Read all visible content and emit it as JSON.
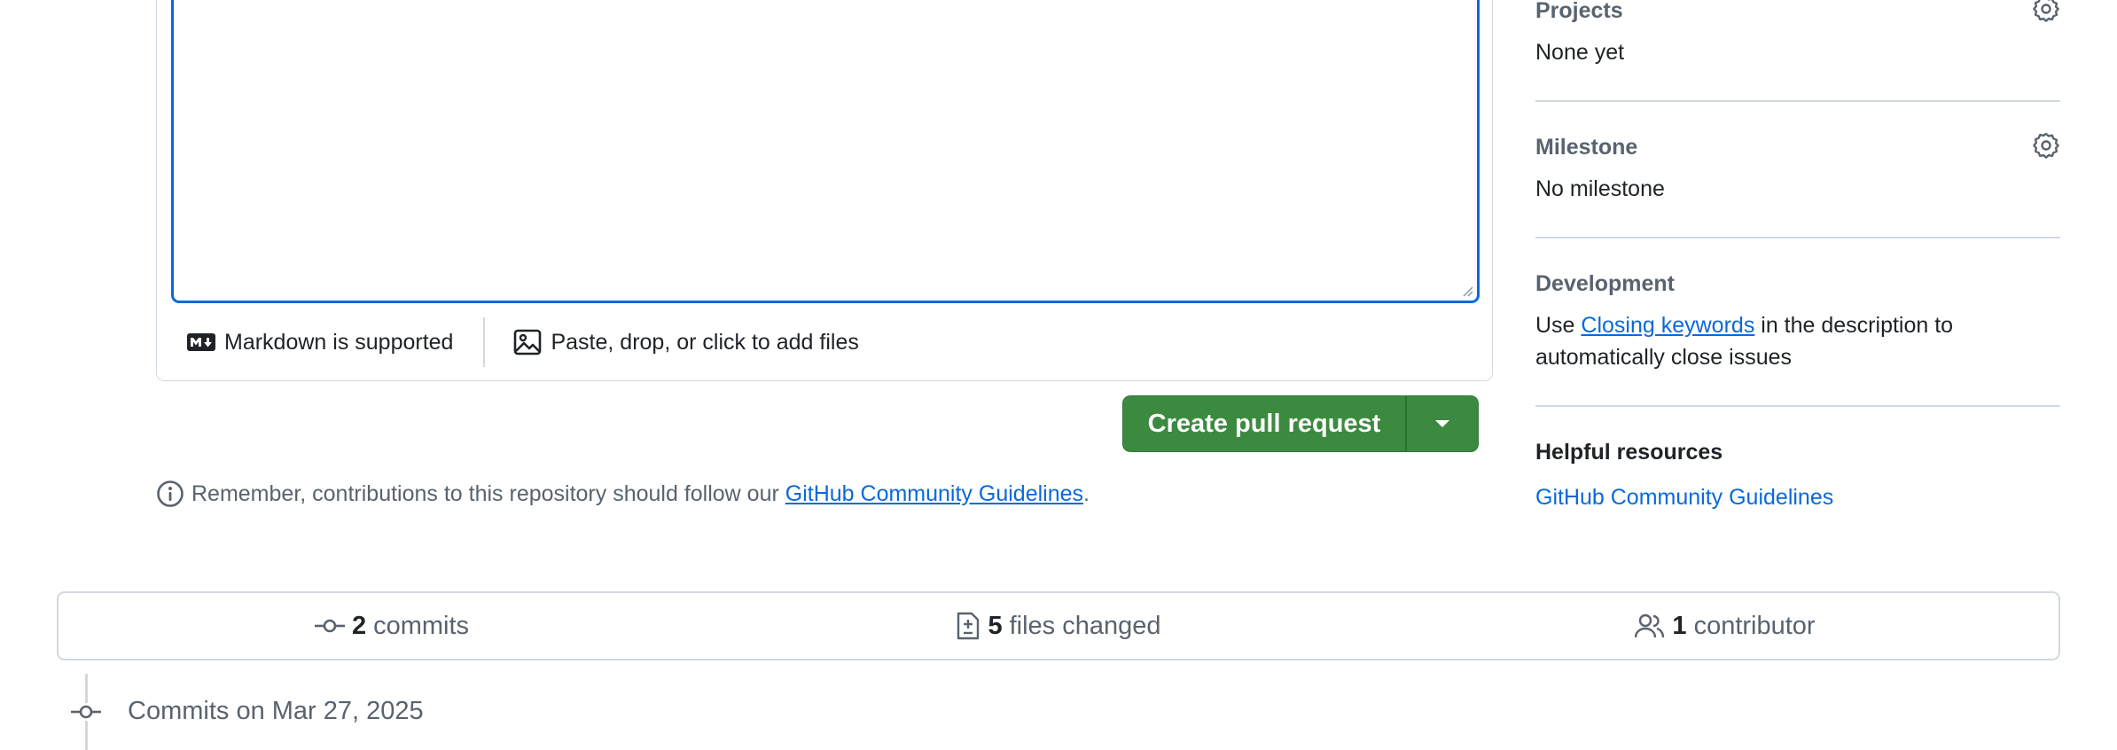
{
  "editor": {
    "markdown_label": "Markdown is supported",
    "attach_label": "Paste, drop, or click to add files"
  },
  "actions": {
    "create_pr_label": "Create pull request"
  },
  "notice": {
    "prefix": "Remember, contributions to this repository should follow our ",
    "link": "GitHub Community Guidelines",
    "suffix": "."
  },
  "sidebar": {
    "projects": {
      "title": "Projects",
      "value": "None yet"
    },
    "milestone": {
      "title": "Milestone",
      "value": "No milestone"
    },
    "development": {
      "title": "Development",
      "prefix": "Use ",
      "link": "Closing keywords",
      "suffix": " in the description to automatically close issues"
    },
    "resources": {
      "title": "Helpful resources",
      "link": "GitHub Community Guidelines"
    }
  },
  "stats": {
    "commits_count": "2",
    "commits_label": "commits",
    "files_count": "5",
    "files_label": "files changed",
    "contributors_count": "1",
    "contributors_label": "contributor"
  },
  "commits_section": {
    "heading": "Commits on Mar 27, 2025"
  },
  "colors": {
    "accent": "#0969da",
    "primary_button": "#3c8a40",
    "border": "#d1d9e0",
    "muted_text": "#59636e"
  }
}
